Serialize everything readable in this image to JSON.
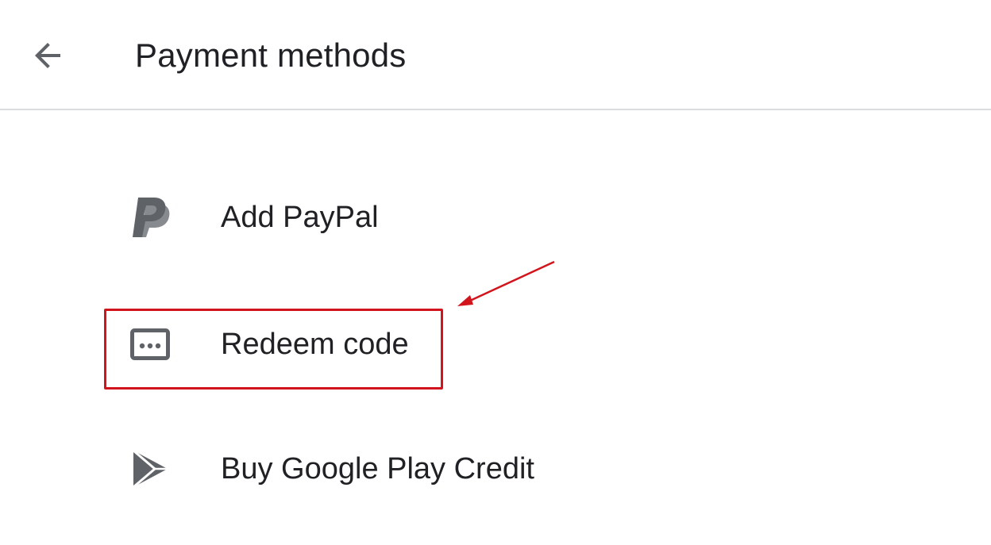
{
  "header": {
    "back_icon": "arrow-back-icon",
    "title": "Payment methods"
  },
  "options": [
    {
      "icon": "paypal-icon",
      "label": "Add PayPal"
    },
    {
      "icon": "redeem-code-icon",
      "label": "Redeem code",
      "highlighted": true
    },
    {
      "icon": "google-play-icon",
      "label": "Buy Google Play Credit"
    }
  ],
  "annotation": {
    "color": "#d2141c",
    "type": "arrow-pointing-to-highlight"
  },
  "colors": {
    "icon": "#5f6368",
    "text": "#202124",
    "divider": "#dadce0"
  }
}
